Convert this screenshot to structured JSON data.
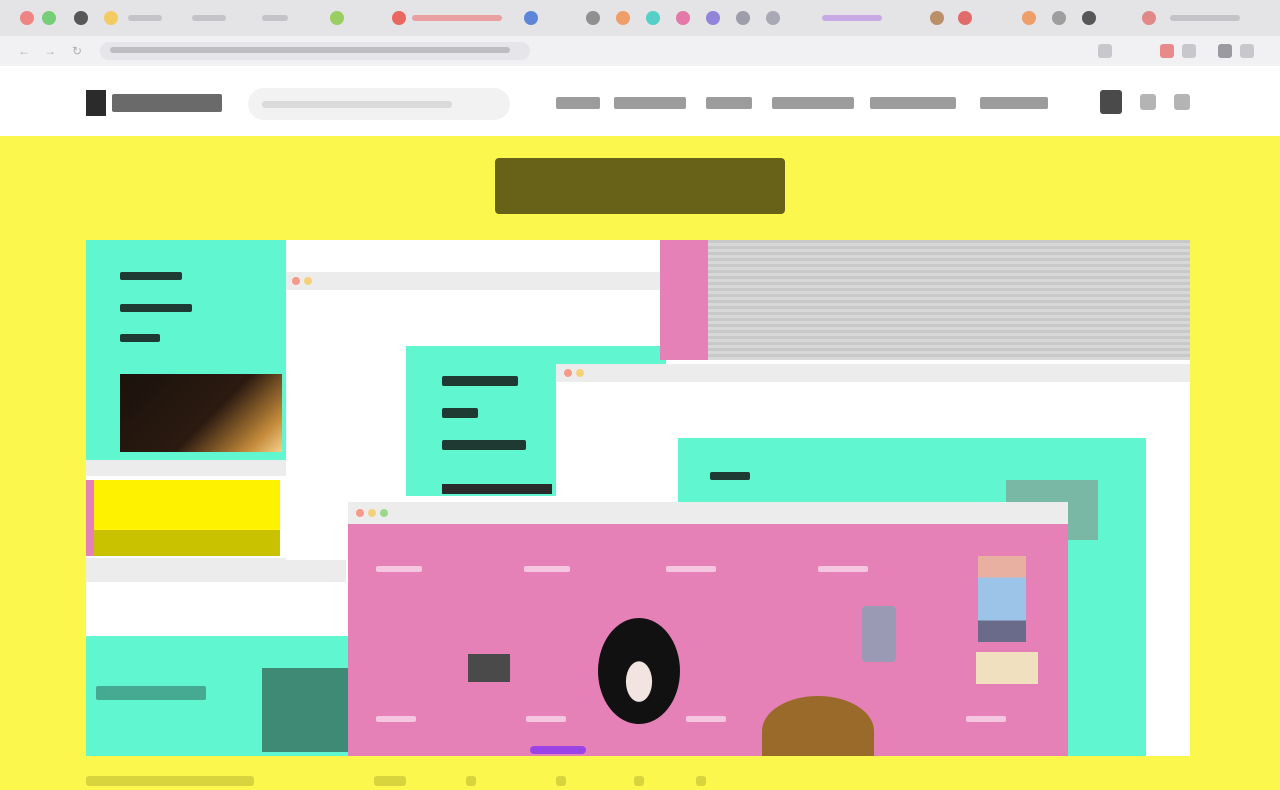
{
  "browser": {
    "tab_dot_colors": [
      "#f06b6b",
      "#f5c542",
      "#5ac85a",
      "#333333",
      "#f5c542",
      "#86c93e",
      "#e8483d",
      "#3b6ed6",
      "#7a7a7a",
      "#f08c4a",
      "#32c9c2",
      "#e25c9a",
      "#7d6bd6",
      "#4aa0e0",
      "#b06bd6",
      "#f08c4a",
      "#333333",
      "#e04c4c"
    ]
  },
  "colors": {
    "banner_background": "#fbf74c",
    "teal": "#5ff6d0",
    "pink": "#e681b8",
    "yellow_panel": "#fff200",
    "olive_panel": "#c9c200",
    "purple_accent": "#9b44e6"
  },
  "icons": {
    "logo": "logo-mark-icon",
    "back": "back-arrow-icon",
    "forward": "forward-arrow-icon",
    "reload": "reload-icon",
    "cart": "cart-icon",
    "user": "user-icon",
    "menu": "menu-icon"
  }
}
